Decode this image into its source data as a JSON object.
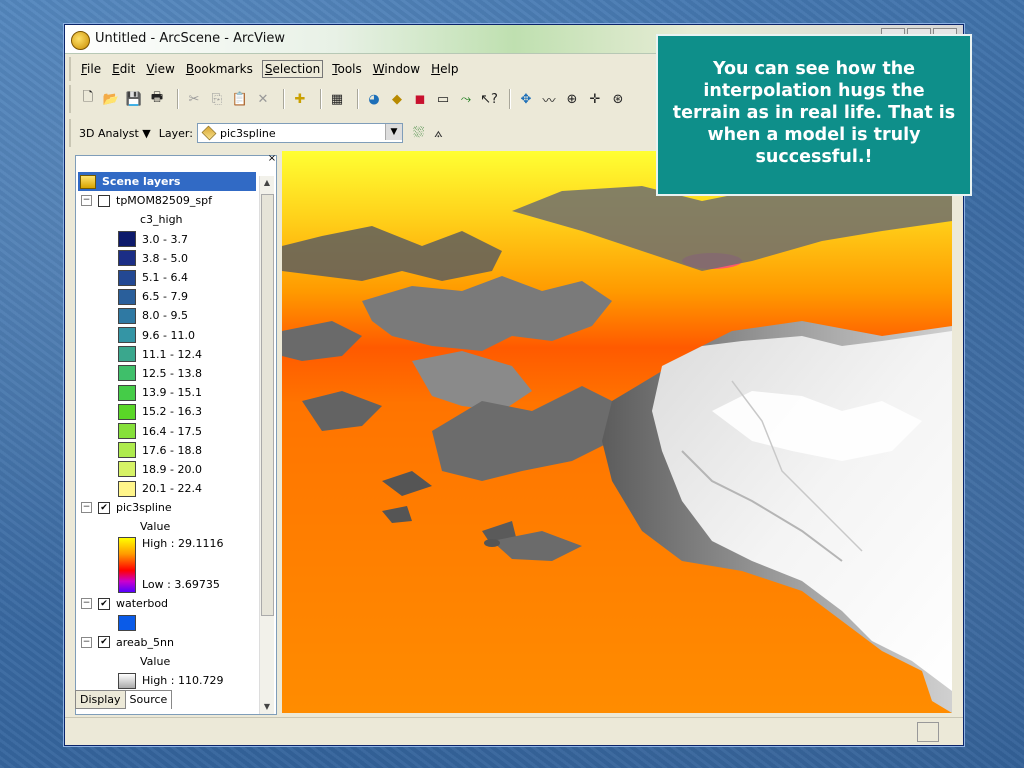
{
  "window": {
    "title": "Untitled - ArcScene - ArcView"
  },
  "menu": {
    "items": [
      {
        "label": "File",
        "key": "F",
        "rest": "ile"
      },
      {
        "label": "Edit",
        "key": "E",
        "rest": "dit"
      },
      {
        "label": "View",
        "key": "V",
        "rest": "iew"
      },
      {
        "label": "Bookmarks",
        "key": "B",
        "rest": "ookmarks"
      },
      {
        "label": "Selection",
        "key": "S",
        "rest": "election"
      },
      {
        "label": "Tools",
        "key": "T",
        "rest": "ools"
      },
      {
        "label": "Window",
        "key": "W",
        "rest": "indow"
      },
      {
        "label": "Help",
        "key": "H",
        "rest": "elp"
      }
    ]
  },
  "toolbar3d": {
    "analyst_label": "3D Analyst ▼",
    "layer_label": "Layer:",
    "layer_value": "pic3spline"
  },
  "toc": {
    "root": "Scene layers",
    "layers": [
      {
        "name": "tpMOM82509_spf",
        "checked": false,
        "field": "c3_high"
      },
      {
        "name": "pic3spline",
        "checked": true,
        "field": "Value",
        "high": "High : 29.1116",
        "low": "Low : 3.69735"
      },
      {
        "name": "waterbod",
        "checked": true
      },
      {
        "name": "areab_5nn",
        "checked": true,
        "field": "Value",
        "high": "High : 110.729"
      }
    ],
    "classes": [
      {
        "label": "3.0 - 3.7",
        "color": "#0d1a6b"
      },
      {
        "label": "3.8 - 5.0",
        "color": "#1b2e86"
      },
      {
        "label": "5.1 - 6.4",
        "color": "#234893"
      },
      {
        "label": "6.5 - 7.9",
        "color": "#2a5f9b"
      },
      {
        "label": "8.0 - 9.5",
        "color": "#2f79a3"
      },
      {
        "label": "9.6 - 11.0",
        "color": "#3495a5"
      },
      {
        "label": "11.1 - 12.4",
        "color": "#3aa78d"
      },
      {
        "label": "12.5 - 13.8",
        "color": "#3fbf6a"
      },
      {
        "label": "13.9 - 15.1",
        "color": "#45cc48"
      },
      {
        "label": "15.2 - 16.3",
        "color": "#5ad627"
      },
      {
        "label": "16.4 - 17.5",
        "color": "#86e03a"
      },
      {
        "label": "17.6 - 18.8",
        "color": "#aeea4d"
      },
      {
        "label": "18.9 - 20.0",
        "color": "#d6f266"
      },
      {
        "label": "20.1 - 22.4",
        "color": "#fff58a"
      }
    ],
    "tabs": [
      "Display",
      "Source"
    ]
  },
  "callout": {
    "text": "You can see how the interpolation hugs the terrain as in real life.  That is when a model is truly successful.!"
  },
  "colors": {
    "callout_bg": "#0e8f8a",
    "selection": "#316ac5",
    "water": "#0a5be8"
  }
}
